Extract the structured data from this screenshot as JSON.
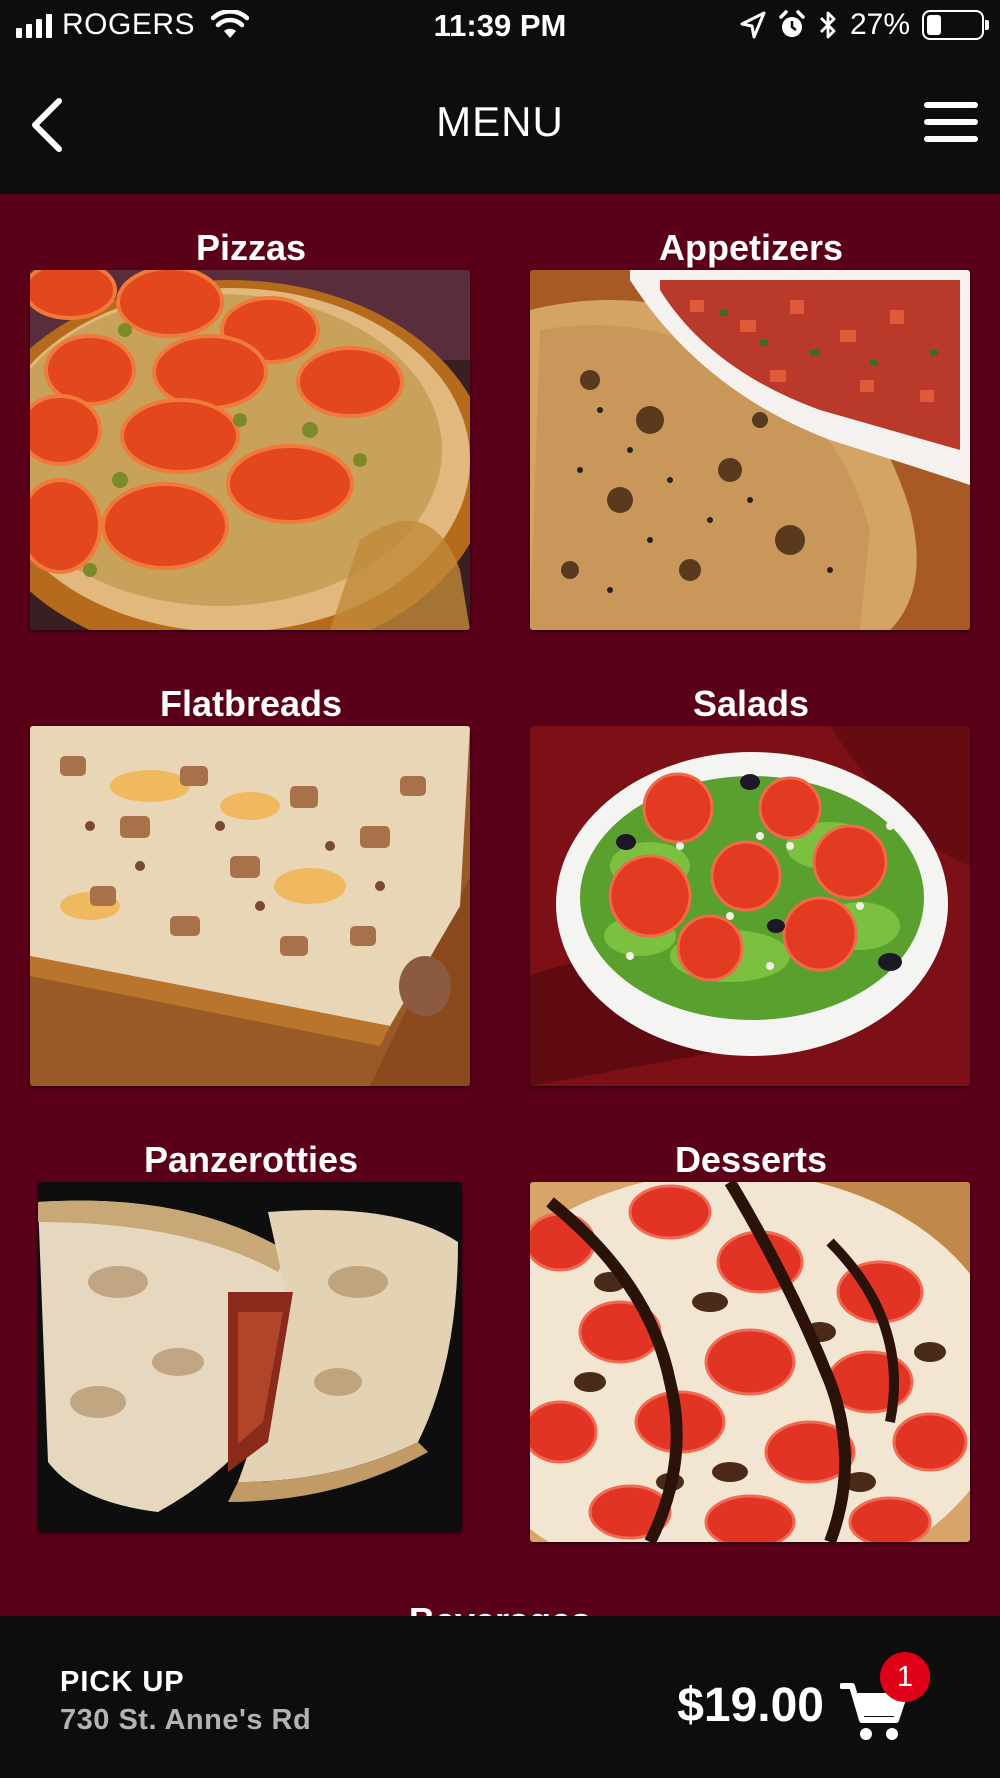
{
  "status_bar": {
    "carrier": "ROGERS",
    "time": "11:39 PM",
    "battery_percent_text": "27%",
    "battery_level": 0.27,
    "icons": [
      "signal-icon",
      "wifi-icon",
      "location-arrow-icon",
      "alarm-icon",
      "bluetooth-icon",
      "battery-icon"
    ]
  },
  "nav": {
    "title": "MENU",
    "back_icon": "chevron-left-icon",
    "menu_icon": "hamburger-icon"
  },
  "categories": [
    {
      "label": "Pizzas",
      "image": "pizza-photo"
    },
    {
      "label": "Appetizers",
      "image": "appetizers-photo"
    },
    {
      "label": "Flatbreads",
      "image": "flatbread-photo"
    },
    {
      "label": "Salads",
      "image": "salad-photo"
    },
    {
      "label": "Panzerotties",
      "image": "panzerotti-photo"
    },
    {
      "label": "Desserts",
      "image": "dessert-photo"
    },
    {
      "label": "Beverages",
      "image": ""
    }
  ],
  "bottom_bar": {
    "pickup_label": "PICK UP",
    "pickup_address": "730 St. Anne's Rd",
    "total": "$19.00",
    "cart_count": "1",
    "cart_icon": "cart-icon"
  },
  "colors": {
    "background": "#0d0d0d",
    "content_background": "#5b0019",
    "badge": "#e00018",
    "address_text": "#b3b3b3"
  }
}
